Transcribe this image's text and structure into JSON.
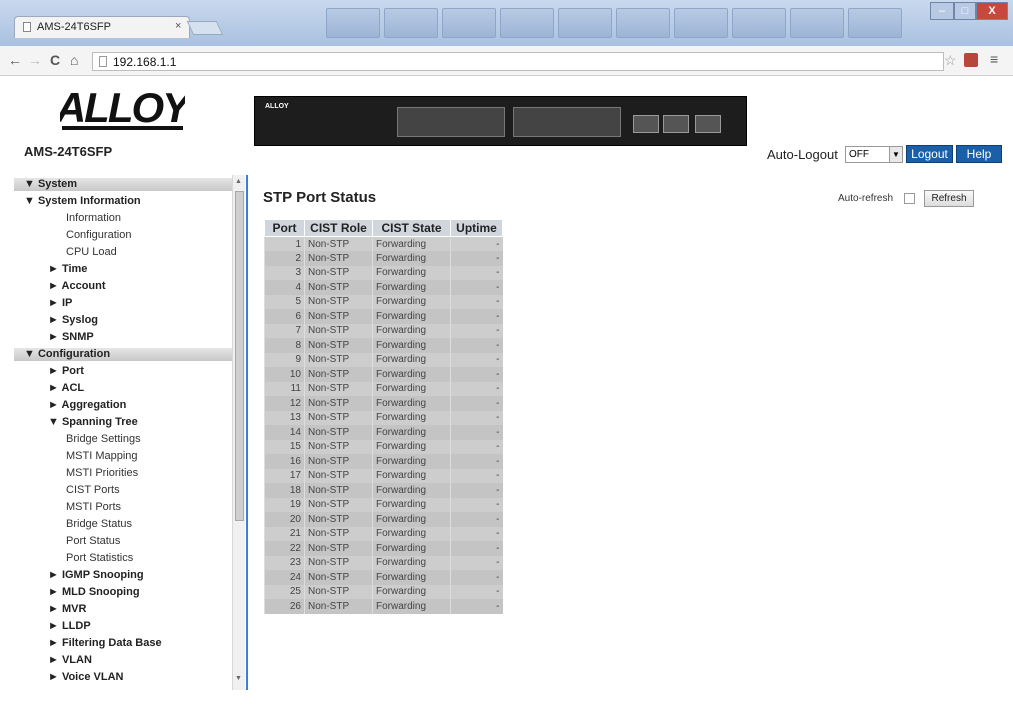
{
  "browser": {
    "tab_title": "AMS-24T6SFP",
    "tab_close": "×",
    "url": "192.168.1.1",
    "back": "←",
    "forward": "→",
    "reload": "C",
    "home": "⌂",
    "star": "☆",
    "menu": "≡",
    "win_min": "–",
    "win_max": "□",
    "win_close": "X"
  },
  "header": {
    "logo_text": "ALLOY",
    "model": "AMS-24T6SFP",
    "switch_brand": "ALLOY",
    "auto_logout_label": "Auto-Logout",
    "auto_logout_value": "OFF",
    "logout_label": "Logout",
    "help_label": "Help",
    "accent_color": "#1a5fa8"
  },
  "menu": {
    "system": "▼ System",
    "system_information": "▼ System Information",
    "information": "Information",
    "configuration_sub": "Configuration",
    "cpu_load": "CPU Load",
    "time": "► Time",
    "account": "► Account",
    "ip": "► IP",
    "syslog": "► Syslog",
    "snmp": "► SNMP",
    "configuration": "▼ Configuration",
    "port": "► Port",
    "acl": "► ACL",
    "aggregation": "► Aggregation",
    "spanning_tree": "▼ Spanning Tree",
    "bridge_settings": "Bridge Settings",
    "msti_mapping": "MSTI Mapping",
    "msti_priorities": "MSTI Priorities",
    "cist_ports": "CIST Ports",
    "msti_ports": "MSTI Ports",
    "bridge_status": "Bridge Status",
    "port_status": "Port Status",
    "port_statistics": "Port Statistics",
    "igmp_snooping": "► IGMP Snooping",
    "mld_snooping": "► MLD Snooping",
    "mvr": "► MVR",
    "lldp": "► LLDP",
    "filtering_data_base": "► Filtering Data Base",
    "vlan": "► VLAN",
    "voice_vlan": "► Voice VLAN"
  },
  "main": {
    "title": "STP Port Status",
    "auto_refresh_label": "Auto-refresh",
    "refresh_label": "Refresh",
    "columns": [
      "Port",
      "CIST Role",
      "CIST State",
      "Uptime"
    ],
    "rows": [
      [
        "1",
        "Non-STP",
        "Forwarding",
        "-"
      ],
      [
        "2",
        "Non-STP",
        "Forwarding",
        "-"
      ],
      [
        "3",
        "Non-STP",
        "Forwarding",
        "-"
      ],
      [
        "4",
        "Non-STP",
        "Forwarding",
        "-"
      ],
      [
        "5",
        "Non-STP",
        "Forwarding",
        "-"
      ],
      [
        "6",
        "Non-STP",
        "Forwarding",
        "-"
      ],
      [
        "7",
        "Non-STP",
        "Forwarding",
        "-"
      ],
      [
        "8",
        "Non-STP",
        "Forwarding",
        "-"
      ],
      [
        "9",
        "Non-STP",
        "Forwarding",
        "-"
      ],
      [
        "10",
        "Non-STP",
        "Forwarding",
        "-"
      ],
      [
        "11",
        "Non-STP",
        "Forwarding",
        "-"
      ],
      [
        "12",
        "Non-STP",
        "Forwarding",
        "-"
      ],
      [
        "13",
        "Non-STP",
        "Forwarding",
        "-"
      ],
      [
        "14",
        "Non-STP",
        "Forwarding",
        "-"
      ],
      [
        "15",
        "Non-STP",
        "Forwarding",
        "-"
      ],
      [
        "16",
        "Non-STP",
        "Forwarding",
        "-"
      ],
      [
        "17",
        "Non-STP",
        "Forwarding",
        "-"
      ],
      [
        "18",
        "Non-STP",
        "Forwarding",
        "-"
      ],
      [
        "19",
        "Non-STP",
        "Forwarding",
        "-"
      ],
      [
        "20",
        "Non-STP",
        "Forwarding",
        "-"
      ],
      [
        "21",
        "Non-STP",
        "Forwarding",
        "-"
      ],
      [
        "22",
        "Non-STP",
        "Forwarding",
        "-"
      ],
      [
        "23",
        "Non-STP",
        "Forwarding",
        "-"
      ],
      [
        "24",
        "Non-STP",
        "Forwarding",
        "-"
      ],
      [
        "25",
        "Non-STP",
        "Forwarding",
        "-"
      ],
      [
        "26",
        "Non-STP",
        "Forwarding",
        "-"
      ]
    ]
  }
}
